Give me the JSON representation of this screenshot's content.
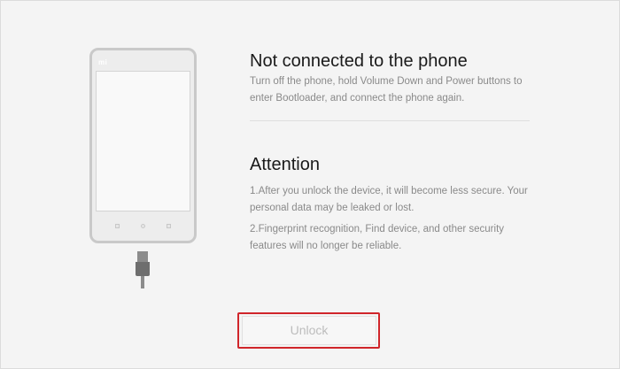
{
  "phone_illustration": {
    "logo_text": "mi"
  },
  "not_connected": {
    "title": "Not connected to the phone",
    "body": "Turn off the phone, hold Volume Down and Power buttons to enter Bootloader, and connect the phone again."
  },
  "attention": {
    "title": "Attention",
    "point_1": "1.After you unlock the device, it will become less secure. Your personal data may be leaked or lost.",
    "point_2": "2.Fingerprint recognition, Find device, and other security features will no longer be reliable."
  },
  "unlock_button": {
    "label": "Unlock",
    "state": "disabled",
    "highlight_color": "#d0252a"
  },
  "colors": {
    "background": "#f4f4f4",
    "title_text": "#1a1a1a",
    "body_text": "#8a8a8a"
  }
}
